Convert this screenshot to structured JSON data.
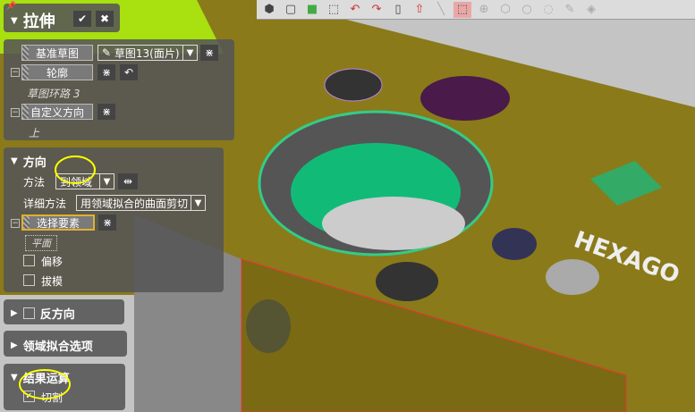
{
  "panel": {
    "title": "拉伸",
    "ok_icon": "check-icon",
    "cancel_icon": "close-icon",
    "base_sketch_label": "基准草图",
    "base_sketch_value": "草图13(面片)",
    "profile_label": "轮廓",
    "profile_value": "草图环路 3",
    "custom_dir_label": "自定义方向",
    "custom_dir_value": "上"
  },
  "direction": {
    "title": "方向",
    "method_label": "方法",
    "method_value": "到领域",
    "detail_label": "详细方法",
    "detail_value": "用领域拟合的曲面剪切",
    "select_label": "选择要素",
    "select_value": "平面",
    "offset_label": "偏移",
    "draft_label": "拔模"
  },
  "reverse": {
    "title": "反方向"
  },
  "fit_options": {
    "title": "领域拟合选项"
  },
  "result": {
    "title": "结果运算",
    "cut_label": "切割",
    "cut_checked": true
  },
  "toolbar": {
    "icons": [
      "view-cube-icon",
      "box-view-icon",
      "color-map-icon",
      "wireframe-icon",
      "rotate-left-icon",
      "rotate-right-icon",
      "split-view-icon",
      "extrude-up-icon",
      "line-select-icon",
      "rect-select-icon",
      "circle-select-icon",
      "polygon-select-icon",
      "lasso-select-icon",
      "freeform-select-icon",
      "brush-select-icon",
      "paint-select-icon"
    ]
  }
}
